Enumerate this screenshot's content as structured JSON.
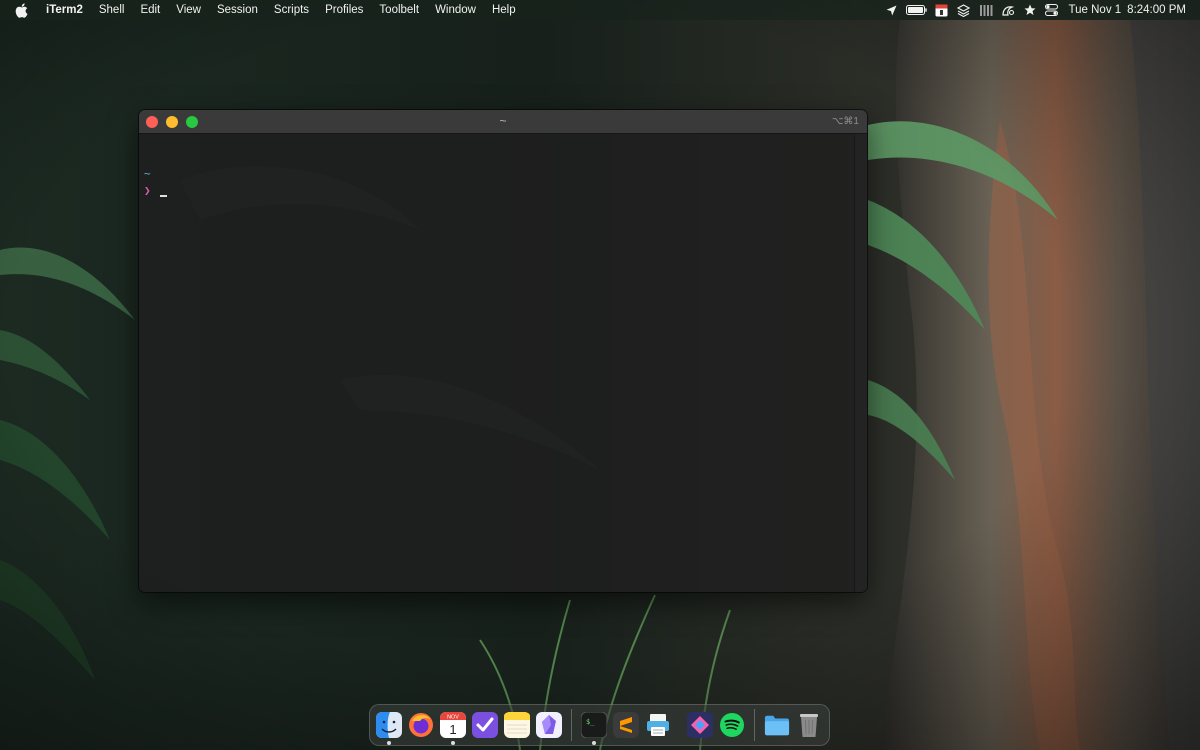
{
  "menubar": {
    "apple_icon": "apple-icon",
    "app_name": "iTerm2",
    "menus": [
      "Shell",
      "Edit",
      "View",
      "Session",
      "Scripts",
      "Profiles",
      "Toolbelt",
      "Window",
      "Help"
    ],
    "status_icons": [
      "location-arrow-icon",
      "battery-icon",
      "calendar-icon",
      "layers-icon",
      "activity-monitor-icon",
      "night-shift-icon",
      "star-icon",
      "control-center-icon"
    ],
    "clock": {
      "date": "Tue Nov 1",
      "time": "8:24:00 PM"
    }
  },
  "terminal": {
    "title": "~",
    "shortcut": "⌥⌘1",
    "cwd": "~",
    "prompt": "❯",
    "colors": {
      "cwd": "#5fb3d9",
      "prompt": "#e25bb1"
    }
  },
  "dock": {
    "items": [
      {
        "name": "finder",
        "icon": "finder-icon",
        "running": true
      },
      {
        "name": "firefox",
        "icon": "firefox-icon",
        "running": false
      },
      {
        "name": "calendar",
        "icon": "calendar-icon",
        "running": true,
        "label_month": "NOV",
        "label_day": "1"
      },
      {
        "name": "omnifocus",
        "icon": "checkmark-app-icon",
        "running": false
      },
      {
        "name": "notes",
        "icon": "notes-icon",
        "running": false
      },
      {
        "name": "obsidian",
        "icon": "obsidian-icon",
        "running": false
      },
      {
        "name": "iterm2",
        "icon": "terminal-icon",
        "running": true,
        "label": "$_"
      },
      {
        "name": "sublime-text",
        "icon": "sublime-icon",
        "running": false
      },
      {
        "name": "preview",
        "icon": "printer-icon",
        "running": false
      },
      {
        "name": "shortcuts",
        "icon": "shortcuts-icon",
        "running": false
      },
      {
        "name": "spotify",
        "icon": "spotify-icon",
        "running": false
      },
      {
        "name": "downloads",
        "icon": "folder-icon",
        "running": false
      },
      {
        "name": "trash",
        "icon": "trash-icon",
        "running": false
      }
    ]
  }
}
